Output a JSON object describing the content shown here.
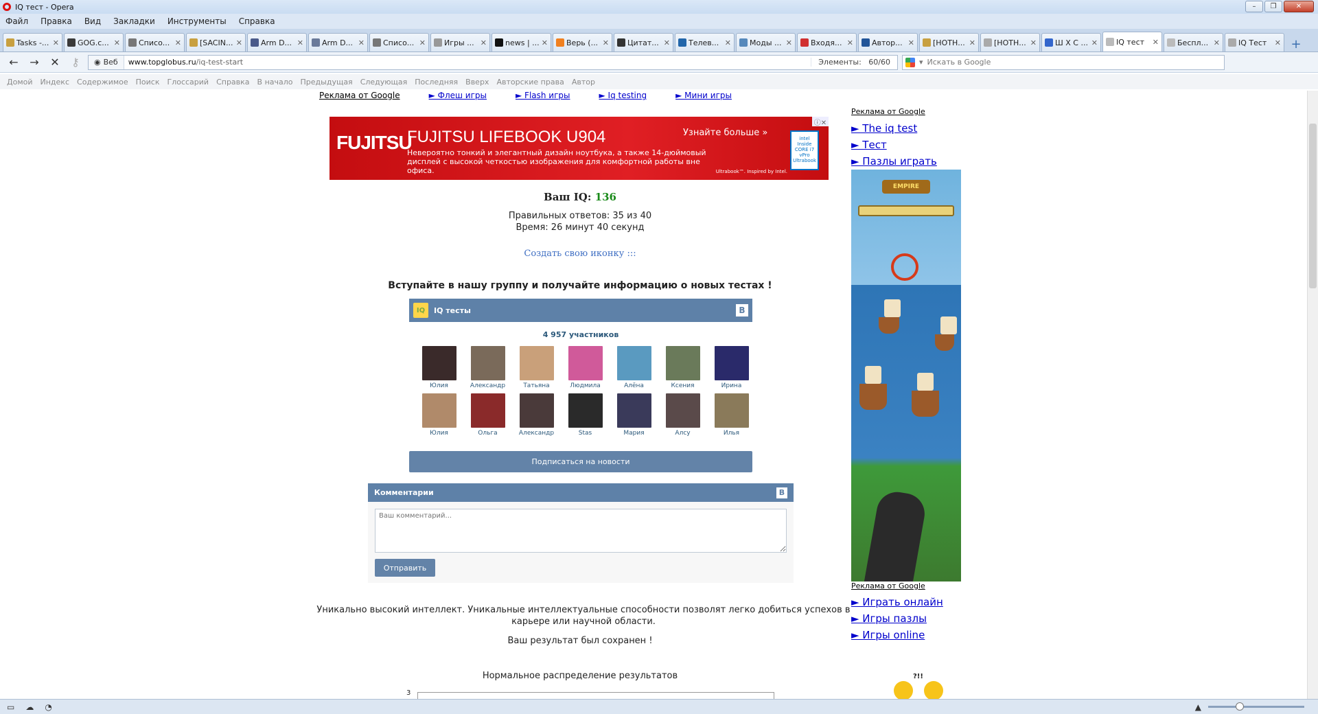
{
  "window": {
    "title": "IQ тест - Opera"
  },
  "menu": [
    "Файл",
    "Правка",
    "Вид",
    "Закладки",
    "Инструменты",
    "Справка"
  ],
  "tabs": [
    {
      "label": "Tasks -...",
      "color": "#c8a040"
    },
    {
      "label": "GOG.c...",
      "color": "#3a3a3a"
    },
    {
      "label": "Списо...",
      "color": "#777777"
    },
    {
      "label": "[SACIN...",
      "color": "#c8a040"
    },
    {
      "label": "Arm D...",
      "color": "#4a5a8a"
    },
    {
      "label": "Arm D...",
      "color": "#6a7a9a"
    },
    {
      "label": "Списо...",
      "color": "#777777"
    },
    {
      "label": "Игры ...",
      "color": "#999999"
    },
    {
      "label": "news | ...",
      "color": "#111111"
    },
    {
      "label": "Верь (...",
      "color": "#f08020"
    },
    {
      "label": "Цитат...",
      "color": "#333333"
    },
    {
      "label": "Телев...",
      "color": "#2266aa"
    },
    {
      "label": "Моды ...",
      "color": "#5588bb"
    },
    {
      "label": "Входя...",
      "color": "#d03030"
    },
    {
      "label": "Автор...",
      "color": "#225599"
    },
    {
      "label": "[НОТН...",
      "color": "#c8a040"
    },
    {
      "label": "[НОТН...",
      "color": "#aaaaaa"
    },
    {
      "label": "Ш Х С ...",
      "color": "#3366cc"
    },
    {
      "label": "IQ тест",
      "color": "#bbbbbb",
      "active": true
    },
    {
      "label": "Беспл...",
      "color": "#bbbbbb"
    },
    {
      "label": "IQ Тест",
      "color": "#aaaaaa"
    }
  ],
  "address": {
    "badge": "Веб",
    "domain": "www.topglobus.ru",
    "path": "/iq-test-start",
    "elements_label": "Элементы:",
    "elements_value": "60/60",
    "search_placeholder": "Искать в Google"
  },
  "navlinks": [
    "Домой",
    "Индекс",
    "Содержимое",
    "Поиск",
    "Глоссарий",
    "Справка",
    "В начало",
    "Предыдущая",
    "Следующая",
    "Последняя",
    "Вверх",
    "Авторские права",
    "Автор"
  ],
  "top_ads": {
    "label": "Реклама от Google",
    "links": [
      "► Флеш игры",
      "► Flash игры",
      "► Iq testing",
      "► Мини игры"
    ]
  },
  "banner": {
    "brand": "FUJITSU",
    "headline": "FUJITSU LIFEBOOK U904",
    "description": "Невероятно тонкий и элегантный дизайн ноутбука, а также 14-дюймовый дисплей с высокой четкостью изображения для комфортной работы вне офиса.",
    "more": "Узнайте больше »",
    "tagline": "Ultrabook™. Inspired by Intel.",
    "intel_badge": "intel Inside CORE i7 vPro Ultrabook"
  },
  "result": {
    "iq_label": "Ваш IQ:",
    "iq_value": "136",
    "correct": "Правильных ответов: 35 из 40",
    "time": "Время: 26 минут 40 секунд",
    "create_icon": "Создать свою иконку :::"
  },
  "group": {
    "heading": "Вступайте в нашу группу и получайте информацию о новых тестах !",
    "name": "IQ тесты",
    "vk_letter": "В",
    "members_count": "4 957 участников",
    "members": [
      {
        "name": "Юлия",
        "color": "#3a2a2a"
      },
      {
        "name": "Александр",
        "color": "#7a6a5a"
      },
      {
        "name": "Татьяна",
        "color": "#c9a07a"
      },
      {
        "name": "Людмила",
        "color": "#d05a9a"
      },
      {
        "name": "Алёна",
        "color": "#5a9ac0"
      },
      {
        "name": "Ксения",
        "color": "#6a7a5a"
      },
      {
        "name": "Ирина",
        "color": "#2a2a6a"
      },
      {
        "name": "Юлия",
        "color": "#b08a6a"
      },
      {
        "name": "Ольга",
        "color": "#8a2a2a"
      },
      {
        "name": "Александр",
        "color": "#4a3a3a"
      },
      {
        "name": "Stas",
        "color": "#2a2a2a"
      },
      {
        "name": "Мария",
        "color": "#3a3a5a"
      },
      {
        "name": "Алсу",
        "color": "#5a4a4a"
      },
      {
        "name": "Илья",
        "color": "#8a7a5a"
      }
    ],
    "subscribe": "Подписаться на новости"
  },
  "comments": {
    "title": "Комментарии",
    "placeholder": "Ваш комментарий...",
    "send": "Отправить"
  },
  "summary": {
    "description": "Уникально высокий интеллект. Уникальные интеллектуальные способности позволят легко добиться успехов в карьере или научной области.",
    "saved": "Ваш результат был сохранен !",
    "distribution_title": "Нормальное распределение результатов",
    "distribution_axis_value": "3"
  },
  "side_ads": {
    "label_top": "Реклама от Google",
    "links_top": [
      "► The iq test",
      "► Тест",
      "► Пазлы играть"
    ],
    "game_logo": "EMPIRE",
    "label_bottom": "Реклама от Google",
    "links_bottom": [
      "► Играть онлайн",
      "► Игры пазлы",
      "► Игры online"
    ]
  },
  "smiley_caption": "?!!"
}
